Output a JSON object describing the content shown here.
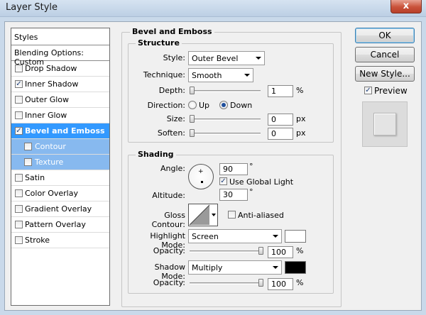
{
  "window": {
    "title": "Layer Style",
    "close_label": "x"
  },
  "styles_panel": {
    "header": "Styles",
    "blending": "Blending Options: Custom",
    "items": [
      {
        "label": "Drop Shadow",
        "checked": false
      },
      {
        "label": "Inner Shadow",
        "checked": true
      },
      {
        "label": "Outer Glow",
        "checked": false
      },
      {
        "label": "Inner Glow",
        "checked": false
      },
      {
        "label": "Bevel and Emboss",
        "checked": true
      },
      {
        "label": "Contour",
        "checked": false
      },
      {
        "label": "Texture",
        "checked": false
      },
      {
        "label": "Satin",
        "checked": false
      },
      {
        "label": "Color Overlay",
        "checked": false
      },
      {
        "label": "Gradient Overlay",
        "checked": false
      },
      {
        "label": "Pattern Overlay",
        "checked": false
      },
      {
        "label": "Stroke",
        "checked": false
      }
    ]
  },
  "bevel": {
    "title": "Bevel and Emboss",
    "structure": {
      "title": "Structure",
      "style_label": "Style:",
      "style_value": "Outer Bevel",
      "technique_label": "Technique:",
      "technique_value": "Smooth",
      "depth_label": "Depth:",
      "depth_value": "1",
      "depth_unit": "%",
      "depth_fraction": 0.01,
      "direction_label": "Direction:",
      "direction_up": "Up",
      "direction_down": "Down",
      "size_label": "Size:",
      "size_value": "0",
      "size_unit": "px",
      "soften_label": "Soften:",
      "soften_value": "0",
      "soften_unit": "px"
    },
    "shading": {
      "title": "Shading",
      "angle_label": "Angle:",
      "angle_value": "90",
      "angle_unit": "°",
      "global_light_label": "Use Global Light",
      "global_light_checked": true,
      "altitude_label": "Altitude:",
      "altitude_value": "30",
      "altitude_unit": "°",
      "gloss_label": "Gloss Contour:",
      "antialiased_label": "Anti-aliased",
      "highlight_label": "Highlight Mode:",
      "highlight_value": "Screen",
      "highlight_color": "#ffffff",
      "hl_opacity_label": "Opacity:",
      "hl_opacity_value": "100",
      "hl_opacity_unit": "%",
      "shadow_label": "Shadow Mode:",
      "shadow_value": "Multiply",
      "shadow_color": "#000000",
      "sh_opacity_label": "Opacity:",
      "sh_opacity_value": "100",
      "sh_opacity_unit": "%"
    }
  },
  "buttons": {
    "ok": "OK",
    "cancel": "Cancel",
    "new_style": "New Style...",
    "preview_label": "Preview",
    "preview_checked": true
  }
}
